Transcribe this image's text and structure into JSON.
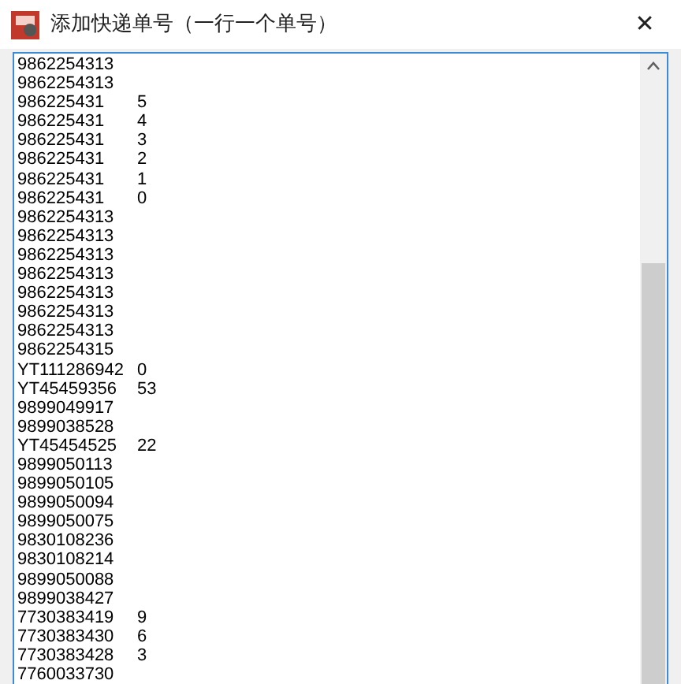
{
  "window": {
    "title": "添加快递单号（一行一个单号）",
    "close": "✕"
  },
  "lines": [
    {
      "text": "9862254313"
    },
    {
      "text": "9862254313"
    },
    {
      "text": "986225431",
      "tail": "5"
    },
    {
      "text": "986225431",
      "tail": "4"
    },
    {
      "text": "986225431",
      "tail": "3"
    },
    {
      "text": "986225431",
      "tail": "2"
    },
    {
      "text": "986225431",
      "tail": "1"
    },
    {
      "text": "986225431",
      "tail": "0"
    },
    {
      "text": "9862254313"
    },
    {
      "text": "9862254313"
    },
    {
      "text": "9862254313"
    },
    {
      "text": "9862254313"
    },
    {
      "text": "9862254313"
    },
    {
      "text": "9862254313"
    },
    {
      "text": "9862254313"
    },
    {
      "text": "9862254315"
    },
    {
      "text": "YT111286942",
      "tail": "0"
    },
    {
      "text": "YT45459356",
      "tail": "53"
    },
    {
      "text": "9899049917"
    },
    {
      "text": "9899038528"
    },
    {
      "text": "YT45454525",
      "tail": "22"
    },
    {
      "text": "9899050113"
    },
    {
      "text": "9899050105"
    },
    {
      "text": "9899050094"
    },
    {
      "text": "9899050075"
    },
    {
      "text": "9830108236"
    },
    {
      "text": "9830108214"
    },
    {
      "text": "9899050088"
    },
    {
      "text": "9899038427"
    },
    {
      "text": "7730383419",
      "tail": "9"
    },
    {
      "text": "7730383430",
      "tail": "6"
    },
    {
      "text": "7730383428",
      "tail": "3"
    },
    {
      "text": "7760033730"
    }
  ]
}
